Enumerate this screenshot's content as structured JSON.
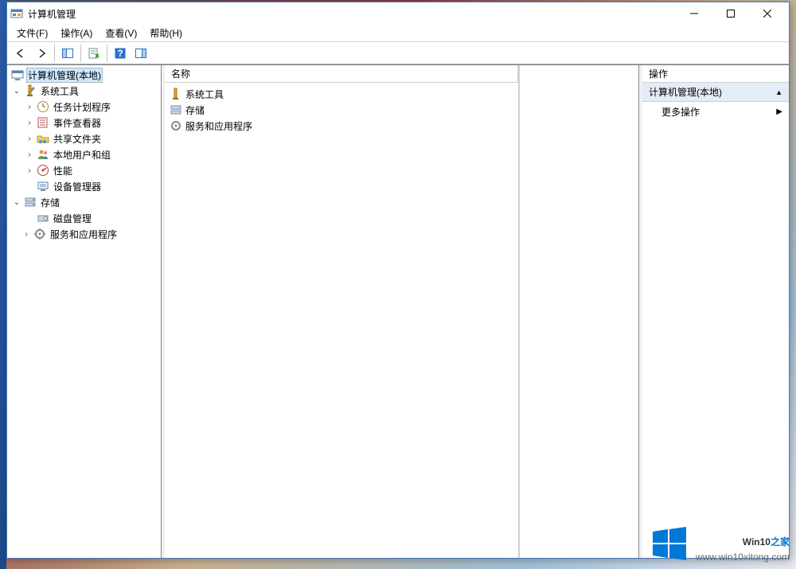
{
  "window": {
    "title": "计算机管理"
  },
  "menu": {
    "file": "文件(F)",
    "action": "操作(A)",
    "view": "查看(V)",
    "help": "帮助(H)"
  },
  "tree": {
    "root": "计算机管理(本地)",
    "sys_tools": "系统工具",
    "task_scheduler": "任务计划程序",
    "event_viewer": "事件查看器",
    "shared_folders": "共享文件夹",
    "local_users": "本地用户和组",
    "performance": "性能",
    "device_manager": "设备管理器",
    "storage": "存储",
    "disk_mgmt": "磁盘管理",
    "services_apps": "服务和应用程序"
  },
  "list": {
    "header_name": "名称",
    "items": [
      {
        "label": "系统工具"
      },
      {
        "label": "存储"
      },
      {
        "label": "服务和应用程序"
      }
    ]
  },
  "actions": {
    "header": "操作",
    "group_title": "计算机管理(本地)",
    "more": "更多操作"
  },
  "watermark": {
    "brand_main": "Win10",
    "brand_accent": "之家",
    "url": "www.win10xitong.com"
  }
}
